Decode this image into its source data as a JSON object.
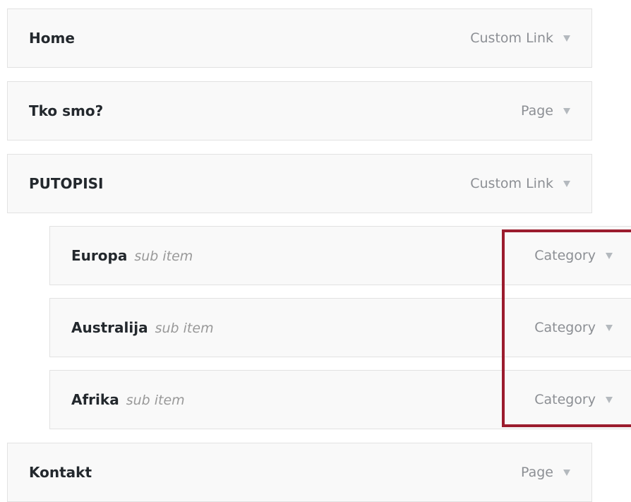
{
  "menu": {
    "items": [
      {
        "name": "Home",
        "sub_label": "",
        "type": "Custom Link"
      },
      {
        "name": "Tko smo?",
        "sub_label": "",
        "type": "Page"
      },
      {
        "name": "PUTOPISI",
        "sub_label": "",
        "type": "Custom Link"
      },
      {
        "name": "Europa",
        "sub_label": "sub item",
        "type": "Category"
      },
      {
        "name": "Australija",
        "sub_label": "sub item",
        "type": "Category"
      },
      {
        "name": "Afrika",
        "sub_label": "sub item",
        "type": "Category"
      },
      {
        "name": "Kontakt",
        "sub_label": "",
        "type": "Page"
      }
    ]
  },
  "colors": {
    "highlight": "#9b1c2e",
    "item_background": "#f9f9f9",
    "item_border": "#e2e2e2"
  },
  "icons": {
    "toggle": "triangle-down-icon"
  }
}
